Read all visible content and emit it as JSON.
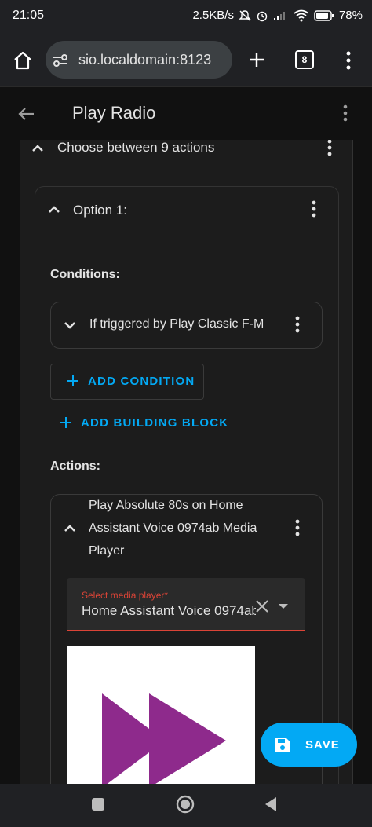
{
  "status_bar": {
    "time": "21:05",
    "net_speed": "2.5KB/s",
    "battery": "78",
    "battery_unit": "%"
  },
  "browser": {
    "url": "sio.localdomain:8123",
    "tab_count": "8",
    "icons": [
      "home-icon",
      "site-settings-icon",
      "new-tab-icon",
      "tab-switcher-icon",
      "overflow-menu-icon"
    ]
  },
  "header": {
    "title": "Play Radio"
  },
  "choose_block": {
    "label": "Choose between 9 actions"
  },
  "option": {
    "label": "Option 1:",
    "conditions_heading": "Conditions:",
    "condition_item": "If triggered by Play Classic F-M",
    "add_condition": "ADD CONDITION",
    "add_building_block": "ADD BUILDING BLOCK",
    "actions_heading": "Actions:",
    "action_title": "Play Absolute 80s on Home Assistant Voice 0974ab Media Player",
    "media_player_label": "Select media player*",
    "media_player_value": "Home Assistant Voice 0974ab"
  },
  "fab": {
    "save_label": "SAVE"
  },
  "colors": {
    "accent": "#03a9f4",
    "error": "#db4437",
    "background": "#111111",
    "card": "#1c1c1c",
    "media_icon": "#8e2a8c"
  }
}
